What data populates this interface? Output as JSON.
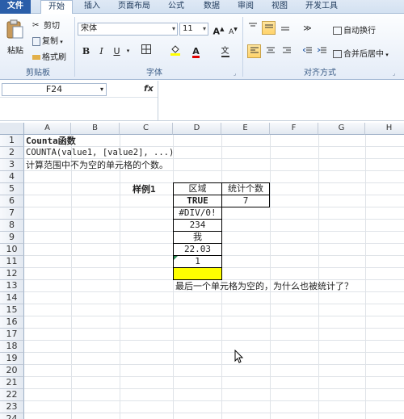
{
  "tabs": [
    "文件",
    "开始",
    "插入",
    "页面布局",
    "公式",
    "数据",
    "审阅",
    "视图",
    "开发工具"
  ],
  "clipboard": {
    "paste": "粘贴",
    "cut": "剪切",
    "copy": "复制",
    "format_painter": "格式刷",
    "group": "剪贴板"
  },
  "font": {
    "name": "宋体",
    "size": "11",
    "group": "字体",
    "wen": "文"
  },
  "alignment": {
    "wrap": "自动换行",
    "merge": "合并后居中",
    "group": "对齐方式"
  },
  "formula_bar": {
    "cell_ref": "F24",
    "fx": "fx",
    "content": ""
  },
  "columns": [
    "A",
    "B",
    "C",
    "D",
    "E",
    "F",
    "G",
    "H"
  ],
  "rows": [
    "1",
    "2",
    "3",
    "4",
    "5",
    "6",
    "7",
    "8",
    "9",
    "10",
    "11",
    "12",
    "13",
    "14",
    "15",
    "16",
    "17",
    "18",
    "19",
    "20",
    "21",
    "22",
    "23",
    "24"
  ],
  "cells": {
    "a1": "Counta函数",
    "a2": "COUNTA(value1, [value2], ...)",
    "a3": "计算范围中不为空的单元格的个数。",
    "c5": "样例1",
    "d5": "区域",
    "e5": "统计个数",
    "d6": "TRUE",
    "e6": "7",
    "d7": "#DIV/0!",
    "d8": "234",
    "d9": "我",
    "d10": "22.03",
    "d11": "1",
    "d12": "",
    "d13": "最后一个单元格为空的，为什么也被统计了？"
  },
  "colors": {
    "highlight": "#ffff00",
    "file_tab": "#2a5ea9"
  }
}
